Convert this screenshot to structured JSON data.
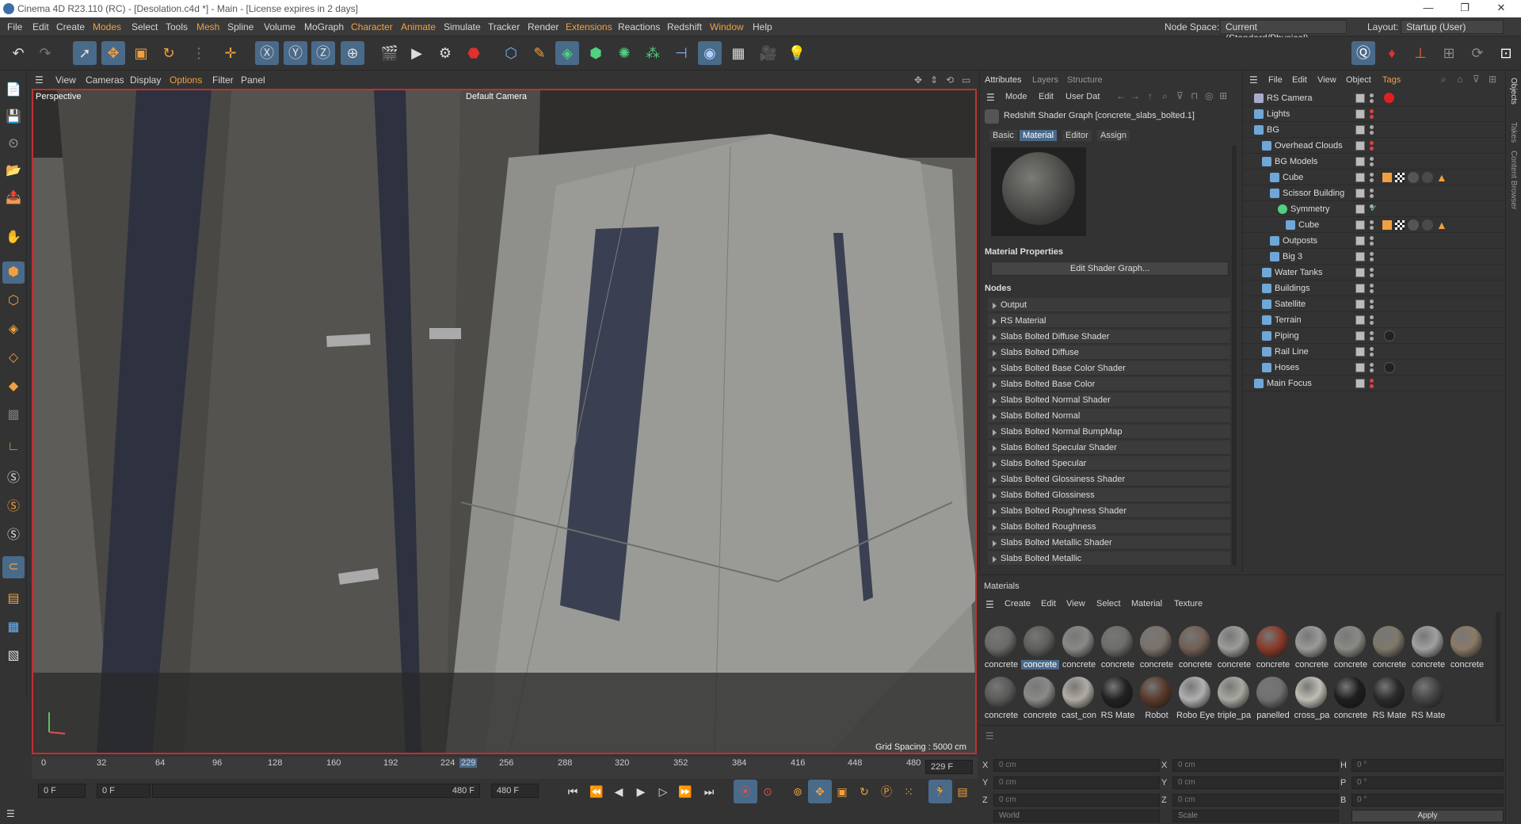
{
  "titlebar": {
    "title": "Cinema 4D R23.110 (RC) - [Desolation.c4d *] - Main - [License expires in 2 days]",
    "min": "—",
    "max": "❐",
    "close": "✕"
  },
  "menubar": {
    "items": [
      "File",
      "Edit",
      "Create",
      "Modes",
      "Select",
      "Tools",
      "Mesh",
      "Spline",
      "Volume",
      "MoGraph",
      "Character",
      "Animate",
      "Simulate",
      "Tracker",
      "Render",
      "Extensions",
      "Reactions",
      "Redshift",
      "Window",
      "Help"
    ],
    "node_space_label": "Node Space:",
    "node_space_value": "Current (Standard/Physical)",
    "layout_label": "Layout:",
    "layout_value": "Startup (User)"
  },
  "viewport_menu": {
    "items": [
      "View",
      "Cameras",
      "Display",
      "Options",
      "Filter",
      "Panel"
    ]
  },
  "viewport": {
    "label": "Perspective",
    "camera": "Default Camera",
    "grid_spacing": "Grid Spacing : 5000 cm"
  },
  "timeline": {
    "ticks": [
      "0",
      "32",
      "64",
      "96",
      "128",
      "160",
      "192",
      "224",
      "229",
      "256",
      "288",
      "320",
      "352",
      "384",
      "416",
      "448",
      "480"
    ],
    "current": "229 F",
    "start": "0 F",
    "start2": "0 F",
    "end": "480 F",
    "end2": "480 F"
  },
  "attributes": {
    "tabs": [
      "Attributes",
      "Layers",
      "Structure"
    ],
    "menu": [
      "Mode",
      "Edit",
      "User Dat"
    ],
    "title": "Redshift Shader Graph [concrete_slabs_bolted.1]",
    "subtabs": [
      "Basic",
      "Material",
      "Editor",
      "Assign"
    ],
    "material_props": "Material Properties",
    "edit_button": "Edit Shader Graph...",
    "nodes_title": "Nodes",
    "nodes": [
      "Output",
      "RS Material",
      "Slabs Bolted Diffuse Shader",
      "Slabs Bolted Diffuse",
      "Slabs Bolted Base Color Shader",
      "Slabs Bolted Base Color",
      "Slabs Bolted Normal Shader",
      "Slabs Bolted Normal",
      "Slabs Bolted Normal BumpMap",
      "Slabs Bolted Specular Shader",
      "Slabs Bolted Specular",
      "Slabs Bolted Glossiness Shader",
      "Slabs Bolted Glossiness",
      "Slabs Bolted Roughness Shader",
      "Slabs Bolted Roughness",
      "Slabs Bolted Metallic Shader",
      "Slabs Bolted Metallic"
    ]
  },
  "objects": {
    "menu": [
      "File",
      "Edit",
      "View",
      "Object",
      "Tags"
    ],
    "items": [
      {
        "name": "RS Camera",
        "indent": 0
      },
      {
        "name": "Lights",
        "indent": 0
      },
      {
        "name": "BG",
        "indent": 0
      },
      {
        "name": "Overhead Clouds",
        "indent": 1
      },
      {
        "name": "BG Models",
        "indent": 1
      },
      {
        "name": "Cube",
        "indent": 2
      },
      {
        "name": "Scissor Building",
        "indent": 2
      },
      {
        "name": "Symmetry",
        "indent": 3
      },
      {
        "name": "Cube",
        "indent": 4
      },
      {
        "name": "Outposts",
        "indent": 2
      },
      {
        "name": "Big 3",
        "indent": 2
      },
      {
        "name": "Water Tanks",
        "indent": 1
      },
      {
        "name": "Buildings",
        "indent": 1
      },
      {
        "name": "Satellite",
        "indent": 1
      },
      {
        "name": "Terrain",
        "indent": 1
      },
      {
        "name": "Piping",
        "indent": 1
      },
      {
        "name": "Rail Line",
        "indent": 1
      },
      {
        "name": "Hoses",
        "indent": 1
      },
      {
        "name": "Main Focus",
        "indent": 0
      }
    ]
  },
  "materials": {
    "title": "Materials",
    "menu": [
      "Create",
      "Edit",
      "View",
      "Select",
      "Material",
      "Texture"
    ],
    "row1": [
      {
        "name": "concrete",
        "color": "#6a6a66"
      },
      {
        "name": "concrete",
        "color": "#5e5e5a"
      },
      {
        "name": "concrete",
        "color": "#888885"
      },
      {
        "name": "concrete",
        "color": "#6d6d6a"
      },
      {
        "name": "concrete",
        "color": "#7a726a"
      },
      {
        "name": "concrete",
        "color": "#735f55"
      },
      {
        "name": "concrete",
        "color": "#9c9c9a"
      },
      {
        "name": "concrete",
        "color": "#8a3a2a"
      },
      {
        "name": "concrete",
        "color": "#9a9a98"
      },
      {
        "name": "concrete",
        "color": "#8a8a84"
      },
      {
        "name": "concrete",
        "color": "#7e786a"
      },
      {
        "name": "concrete",
        "color": "#a0a0a0"
      },
      {
        "name": "concrete",
        "color": "#8a7a66"
      }
    ],
    "row2": [
      {
        "name": "concrete",
        "color": "#5a5a58"
      },
      {
        "name": "concrete",
        "color": "#8a8a88"
      },
      {
        "name": "cast_con",
        "color": "#b0aca4"
      },
      {
        "name": "RS Mate",
        "color": "#222222"
      },
      {
        "name": "Robot",
        "color": "#5a3a2a"
      },
      {
        "name": "Robo Eye",
        "color": "#b0b0b0"
      },
      {
        "name": "triple_pa",
        "color": "#a8a8a0"
      },
      {
        "name": "panelled",
        "color": "#707070"
      },
      {
        "name": "cross_pa",
        "color": "#c0bdb4"
      },
      {
        "name": "concrete",
        "color": "#1e1e1e"
      },
      {
        "name": "RS Mate",
        "color": "#2a2a2a"
      },
      {
        "name": "RS Mate",
        "color": "#444444"
      }
    ]
  },
  "coords": {
    "x": "X",
    "y": "Y",
    "z": "Z",
    "h": "H",
    "p": "P",
    "b": "B",
    "val_cm": "0 cm",
    "val_deg": "0 °",
    "world": "World",
    "scale": "Scale",
    "apply": "Apply"
  },
  "right_strip": [
    "Objects",
    "Takes",
    "Content Browser"
  ]
}
